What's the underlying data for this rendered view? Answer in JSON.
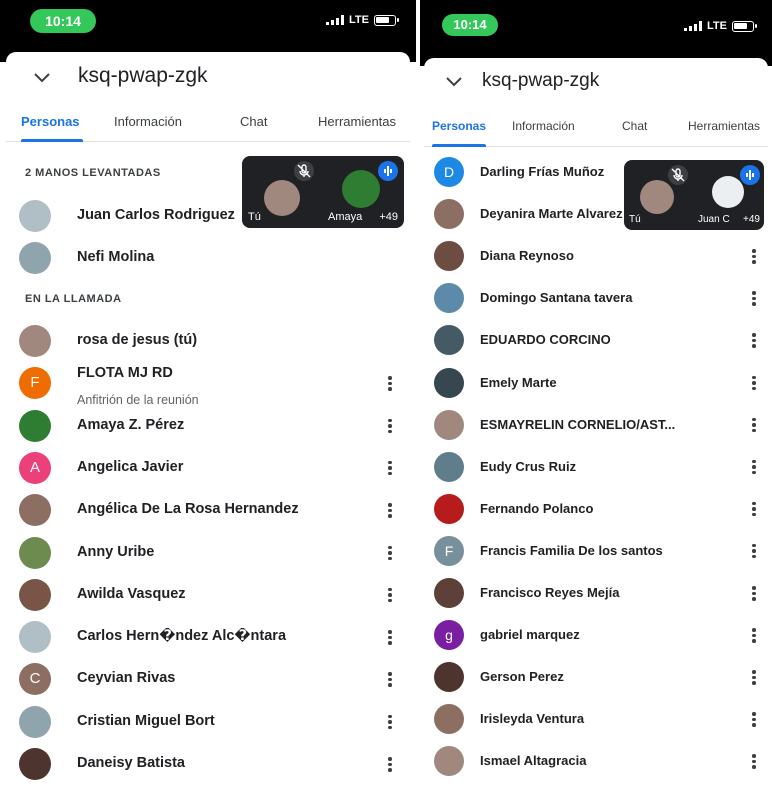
{
  "left": {
    "status": {
      "time": "10:14",
      "network": "LTE"
    },
    "title": "ksq-pwap-zgk",
    "tabs": [
      "Personas",
      "Información",
      "Chat",
      "Herramientas"
    ],
    "sections": {
      "raised": "2 MANOS LEVANTADAS",
      "incall": "EN LA LLAMADA"
    },
    "selfview": {
      "you": "Tú",
      "other": "Amaya",
      "count": "+49"
    },
    "raised": [
      {
        "name": "Juan Carlos Rodriguez",
        "color": "#b0bec5"
      },
      {
        "name": "Nefi Molina",
        "color": "#90a4ae"
      }
    ],
    "people": [
      {
        "name": "rosa de jesus (tú)",
        "mic": "none",
        "more": false,
        "color": "#a1887f"
      },
      {
        "name": "FLOTA MJ RD",
        "sub": "Anfitrión de la reunión",
        "initial": "F",
        "mic": "muted",
        "more": true,
        "color": "#ef6c00"
      },
      {
        "name": "Amaya Z. Pérez",
        "mic": "speaking",
        "more": true,
        "color": "#2e7d32"
      },
      {
        "name": "Angelica Javier",
        "initial": "A",
        "mic": "muted",
        "more": true,
        "color": "#ec407a"
      },
      {
        "name": "Angélica De La Rosa Hernandez",
        "mic": "muted",
        "more": true,
        "color": "#8d6e63"
      },
      {
        "name": "Anny Uribe",
        "mic": "muted",
        "more": true,
        "color": "#6d8b4e"
      },
      {
        "name": "Awilda Vasquez",
        "mic": "muted",
        "more": true,
        "color": "#795548"
      },
      {
        "name": "Carlos Hern�ndez Alc�ntara",
        "mic": "muted",
        "more": true,
        "color": "#b0bec5"
      },
      {
        "name": "Ceyvian Rivas",
        "initial": "C",
        "mic": "muted",
        "more": true,
        "color": "#8d6e63"
      },
      {
        "name": "Cristian Miguel Bort",
        "mic": "muted",
        "more": true,
        "color": "#90a4ae"
      },
      {
        "name": "Daneisy Batista",
        "mic": "muted",
        "more": true,
        "color": "#4e342e"
      }
    ]
  },
  "right": {
    "status": {
      "time": "10:14",
      "network": "LTE"
    },
    "title": "ksq-pwap-zgk",
    "tabs": [
      "Personas",
      "Información",
      "Chat",
      "Herramientas"
    ],
    "selfview": {
      "you": "Tú",
      "other": "Juan C",
      "count": "+49"
    },
    "people": [
      {
        "name": "Darling Frías Muñoz",
        "initial": "D",
        "mic": "none",
        "color": "#1e88e5"
      },
      {
        "name": "Deyanira Marte Alvarez",
        "mic": "none",
        "color": "#8d6e63"
      },
      {
        "name": "Diana Reynoso",
        "mic": "muted",
        "color": "#6d4c41"
      },
      {
        "name": "Domingo Santana tavera",
        "mic": "muted",
        "color": "#5c8aa8"
      },
      {
        "name": "EDUARDO CORCINO",
        "mic": "muted",
        "color": "#455a64"
      },
      {
        "name": "Emely Marte",
        "mic": "muted",
        "color": "#37474f"
      },
      {
        "name": "ESMAYRELIN CORNELIO/AST...",
        "mic": "muted",
        "color": "#a1887f"
      },
      {
        "name": "Eudy Crus Ruiz",
        "mic": "muted",
        "color": "#607d8b"
      },
      {
        "name": "Fernando Polanco",
        "mic": "muted",
        "color": "#b71c1c"
      },
      {
        "name": "Francis Familia De los santos",
        "initial": "F",
        "mic": "muted",
        "color": "#78909c"
      },
      {
        "name": "Francisco Reyes Mejía",
        "mic": "muted",
        "color": "#5d4037"
      },
      {
        "name": "gabriel marquez",
        "initial": "g",
        "mic": "muted",
        "color": "#7b1fa2"
      },
      {
        "name": "Gerson Perez",
        "mic": "muted",
        "color": "#4e342e"
      },
      {
        "name": "Irisleyda Ventura",
        "mic": "muted",
        "color": "#8d6e63"
      },
      {
        "name": "Ismael Altagracia",
        "mic": "muted",
        "color": "#a1887f"
      }
    ]
  }
}
